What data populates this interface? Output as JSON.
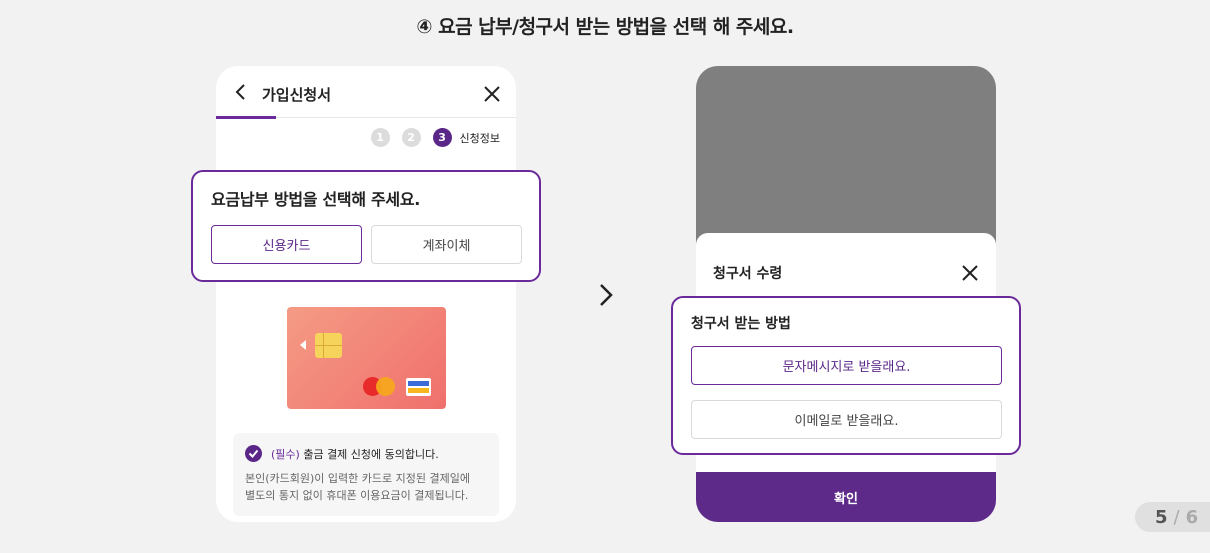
{
  "title": "④ 요금 납부/청구서 받는 방법을 선택 해 주세요.",
  "left_phone": {
    "header_title": "가입신청서",
    "steps": [
      "1",
      "2",
      "3"
    ],
    "active_step_label": "신청정보",
    "agree": {
      "required_tag": "(필수)",
      "text": "출금 결제 신청에 동의합니다.",
      "desc_line1": "본인(카드회원)이 입력한 카드로 지정된 결제일에",
      "desc_line2": "별도의 통지 없이 휴대폰 이용요금이 결제됩니다."
    }
  },
  "left_popup": {
    "question": "요금납부 방법을 선택해 주세요.",
    "options": [
      "신용카드",
      "계좌이체"
    ],
    "selected": "신용카드"
  },
  "right_phone": {
    "sheet_title": "청구서 수령",
    "confirm_label": "확인"
  },
  "right_popup": {
    "question": "청구서 받는 방법",
    "options": [
      "문자메시지로 받을래요.",
      "이메일로 받을래요."
    ],
    "selected": "문자메시지로 받을래요."
  },
  "pager": {
    "current": "5",
    "separator": "/",
    "total": "6"
  },
  "colors": {
    "accent": "#5d2a8a",
    "card": "#f2847a",
    "overlay": "#7f7f7f"
  }
}
